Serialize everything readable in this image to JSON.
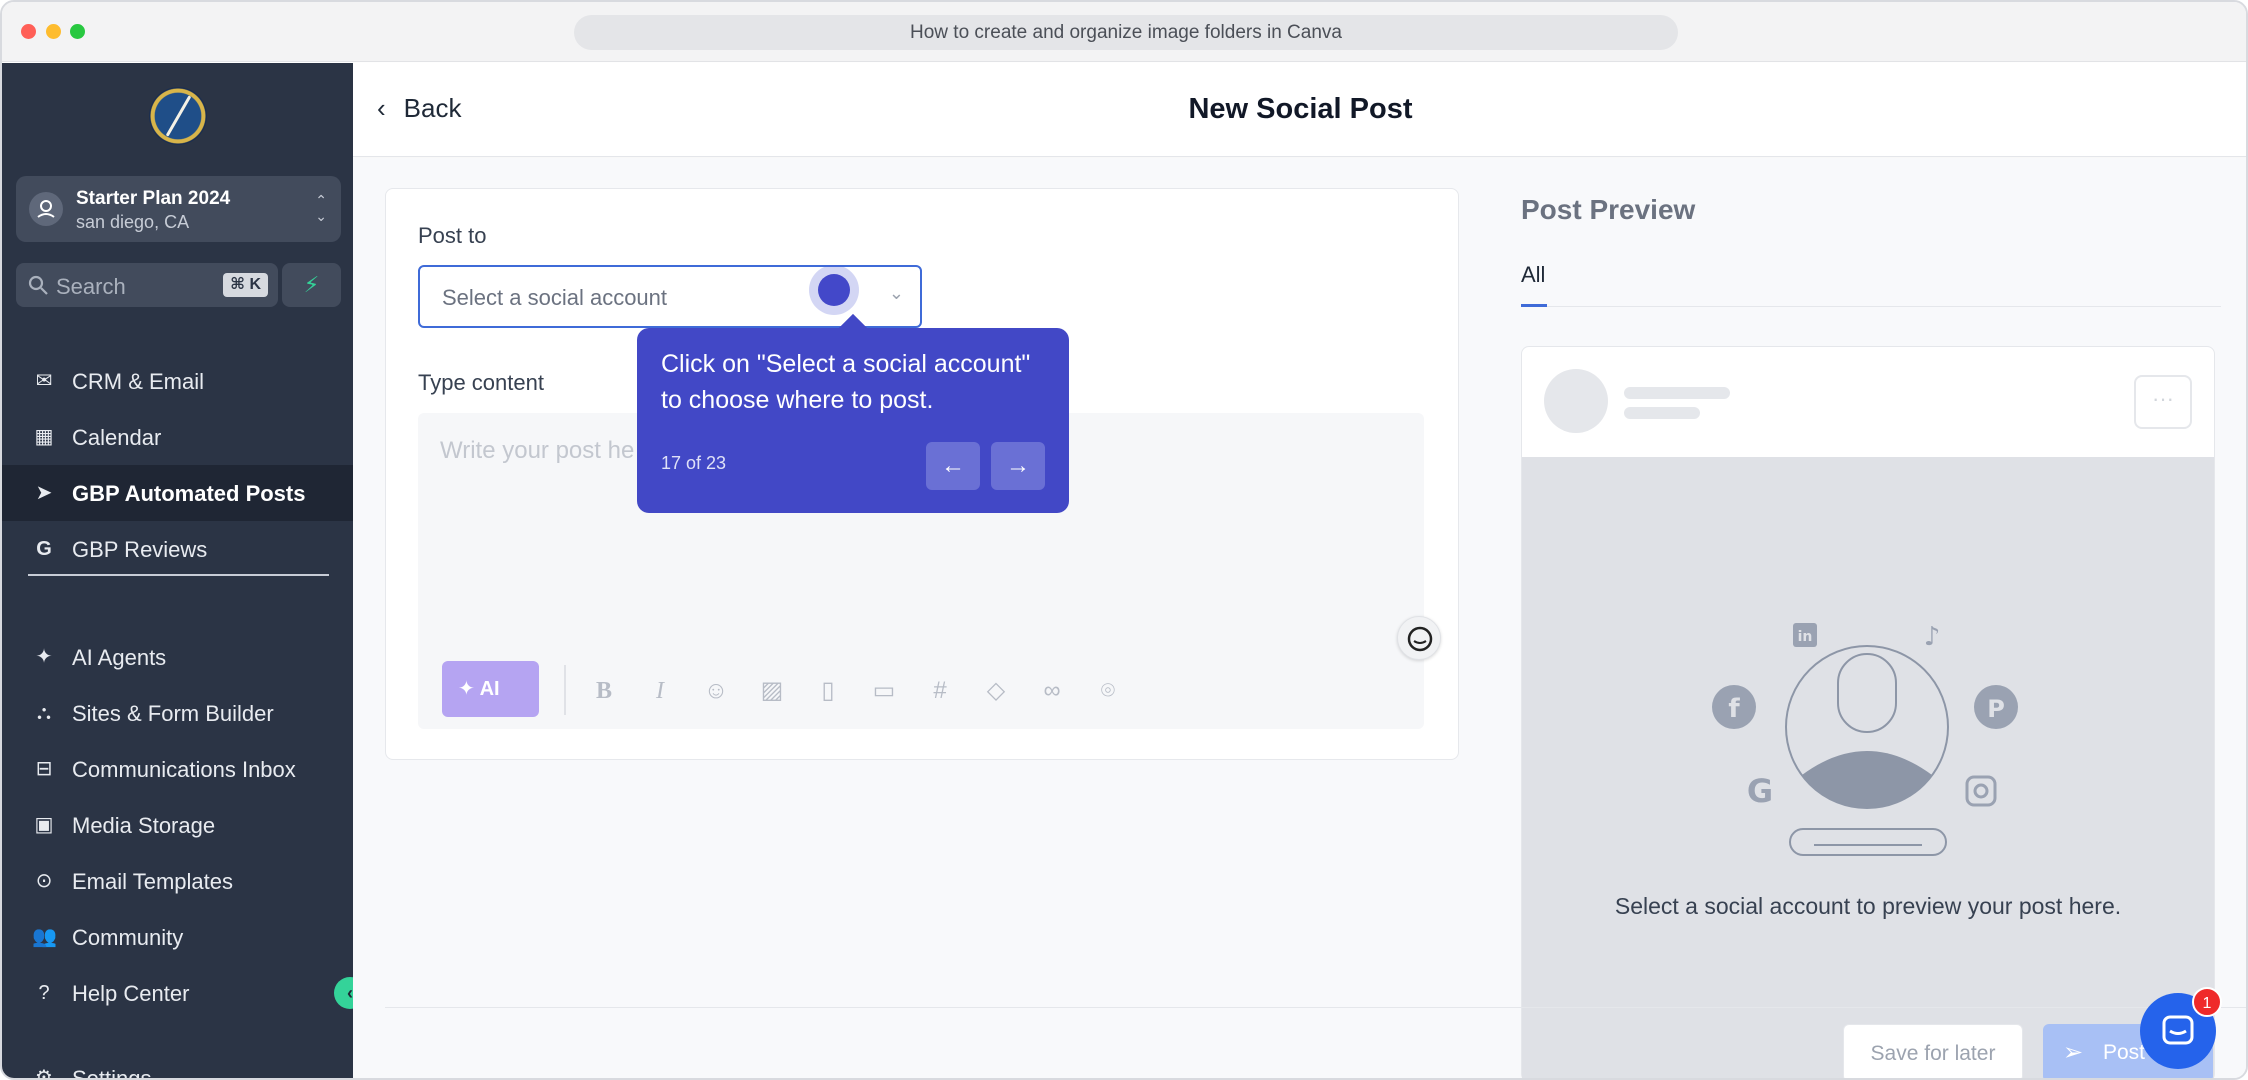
{
  "browser": {
    "url_title": "How to create and organize image folders in Canva"
  },
  "sidebar": {
    "account": {
      "name": "Starter Plan 2024",
      "location": "san diego, CA"
    },
    "search": {
      "placeholder": "Search",
      "shortcut": "⌘ K"
    },
    "items": [
      {
        "label": "CRM & Email",
        "icon": "mail-icon"
      },
      {
        "label": "Calendar",
        "icon": "calendar-icon"
      },
      {
        "label": "GBP Automated Posts",
        "icon": "send-icon",
        "active": true
      },
      {
        "label": "GBP Reviews",
        "icon": "google-icon"
      },
      {
        "label": "AI Agents",
        "icon": "sparkle-icon"
      },
      {
        "label": "Sites & Form Builder",
        "icon": "sitemap-icon"
      },
      {
        "label": "Communications Inbox",
        "icon": "inbox-icon"
      },
      {
        "label": "Media Storage",
        "icon": "image-gallery-icon"
      },
      {
        "label": "Email Templates",
        "icon": "play-circle-icon"
      },
      {
        "label": "Community",
        "icon": "users-icon"
      },
      {
        "label": "Help Center",
        "icon": "help-icon"
      },
      {
        "label": "Settings",
        "icon": "gear-icon"
      }
    ]
  },
  "header": {
    "back_label": "Back",
    "title": "New Social Post"
  },
  "composer": {
    "post_to_label": "Post to",
    "select_placeholder": "Select a social account",
    "type_content_label": "Type content",
    "editor_placeholder": "Write your post he",
    "ai_label": "AI"
  },
  "tooltip": {
    "text": "Click on \"Select a social account\" to choose where to post.",
    "step": "17 of 23"
  },
  "preview": {
    "title": "Post Preview",
    "tab": "All",
    "message": "Select a social account to preview your post here."
  },
  "footer": {
    "save_label": "Save for later",
    "post_label": "Post"
  },
  "chat": {
    "badge_count": "1"
  },
  "colors": {
    "sidebar_bg": "#2b3445",
    "accent": "#3f6bd8",
    "tooltip_bg": "#4248c6",
    "ai_purple": "#b5a4f2"
  }
}
